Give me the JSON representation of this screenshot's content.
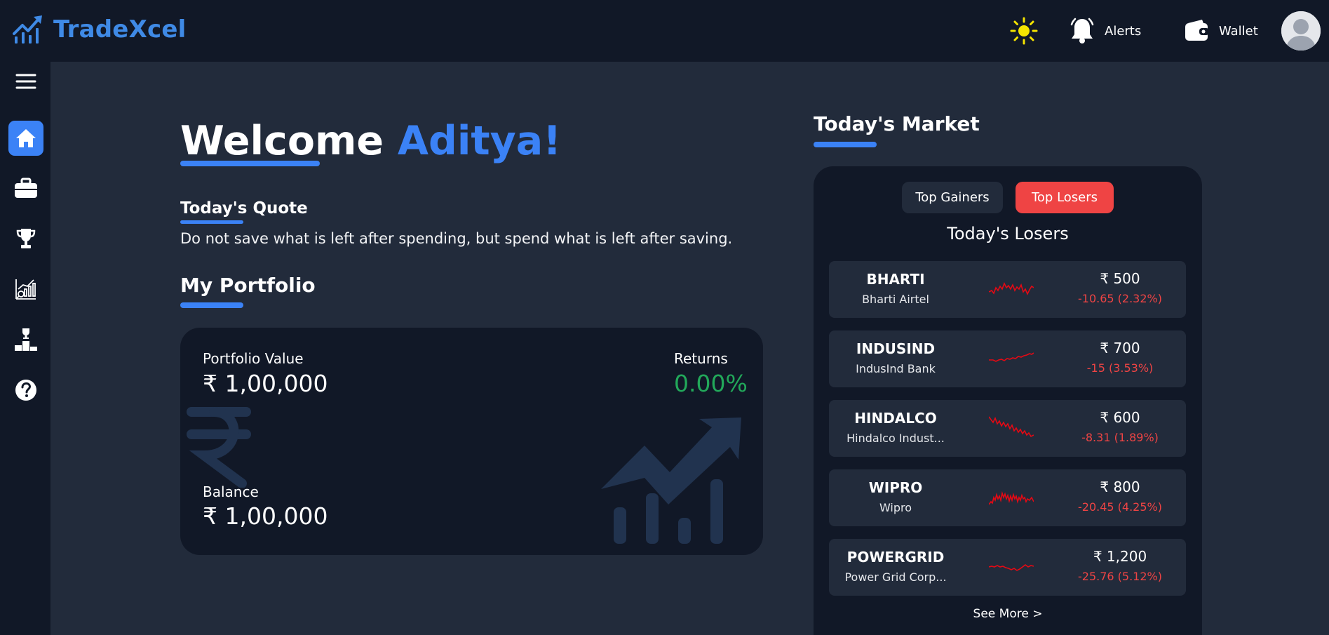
{
  "brand": {
    "name": "TradeXcel"
  },
  "nav": {
    "alerts_label": "Alerts",
    "wallet_label": "Wallet"
  },
  "welcome": {
    "greeting": "Welcome",
    "user": "Aditya!"
  },
  "quote": {
    "heading": "Today's Quote",
    "text": "Do not save what is left after spending, but spend what is left after saving."
  },
  "portfolio": {
    "heading": "My Portfolio",
    "value_label": "Portfolio Value",
    "value": "₹ 1,00,000",
    "returns_label": "Returns",
    "returns": "0.00%",
    "balance_label": "Balance",
    "balance": "₹ 1,00,000"
  },
  "market": {
    "heading": "Today's Market",
    "tabs": [
      "Top Gainers",
      "Top Losers"
    ],
    "active_tab": "Top Losers",
    "list_title": "Today's Losers",
    "stocks": [
      {
        "symbol": "BHARTI",
        "name": "Bharti Airtel",
        "price": "₹ 500",
        "change": "-10.65 (2.32%)"
      },
      {
        "symbol": "INDUSIND",
        "name": "IndusInd Bank",
        "price": "₹ 700",
        "change": "-15 (3.53%)"
      },
      {
        "symbol": "HINDALCO",
        "name": "Hindalco Indust...",
        "price": "₹ 600",
        "change": "-8.31 (1.89%)"
      },
      {
        "symbol": "WIPRO",
        "name": "Wipro",
        "price": "₹ 800",
        "change": "-20.45 (4.25%)"
      },
      {
        "symbol": "POWERGRID",
        "name": "Power Grid Corp...",
        "price": "₹ 1,200",
        "change": "-25.76 (5.12%)"
      }
    ],
    "see_more": "See More >"
  },
  "colors": {
    "accent": "#3b82f6",
    "loss": "#ef4444",
    "gain": "#22a85a",
    "panel": "#111827",
    "background": "#222b3b"
  },
  "icons": [
    "logo-chart-icon",
    "sun-icon",
    "bell-icon",
    "wallet-icon",
    "avatar-icon",
    "menu-icon",
    "home-icon",
    "briefcase-icon",
    "trophy-icon",
    "analytics-icon",
    "leaderboard-icon",
    "help-icon"
  ]
}
